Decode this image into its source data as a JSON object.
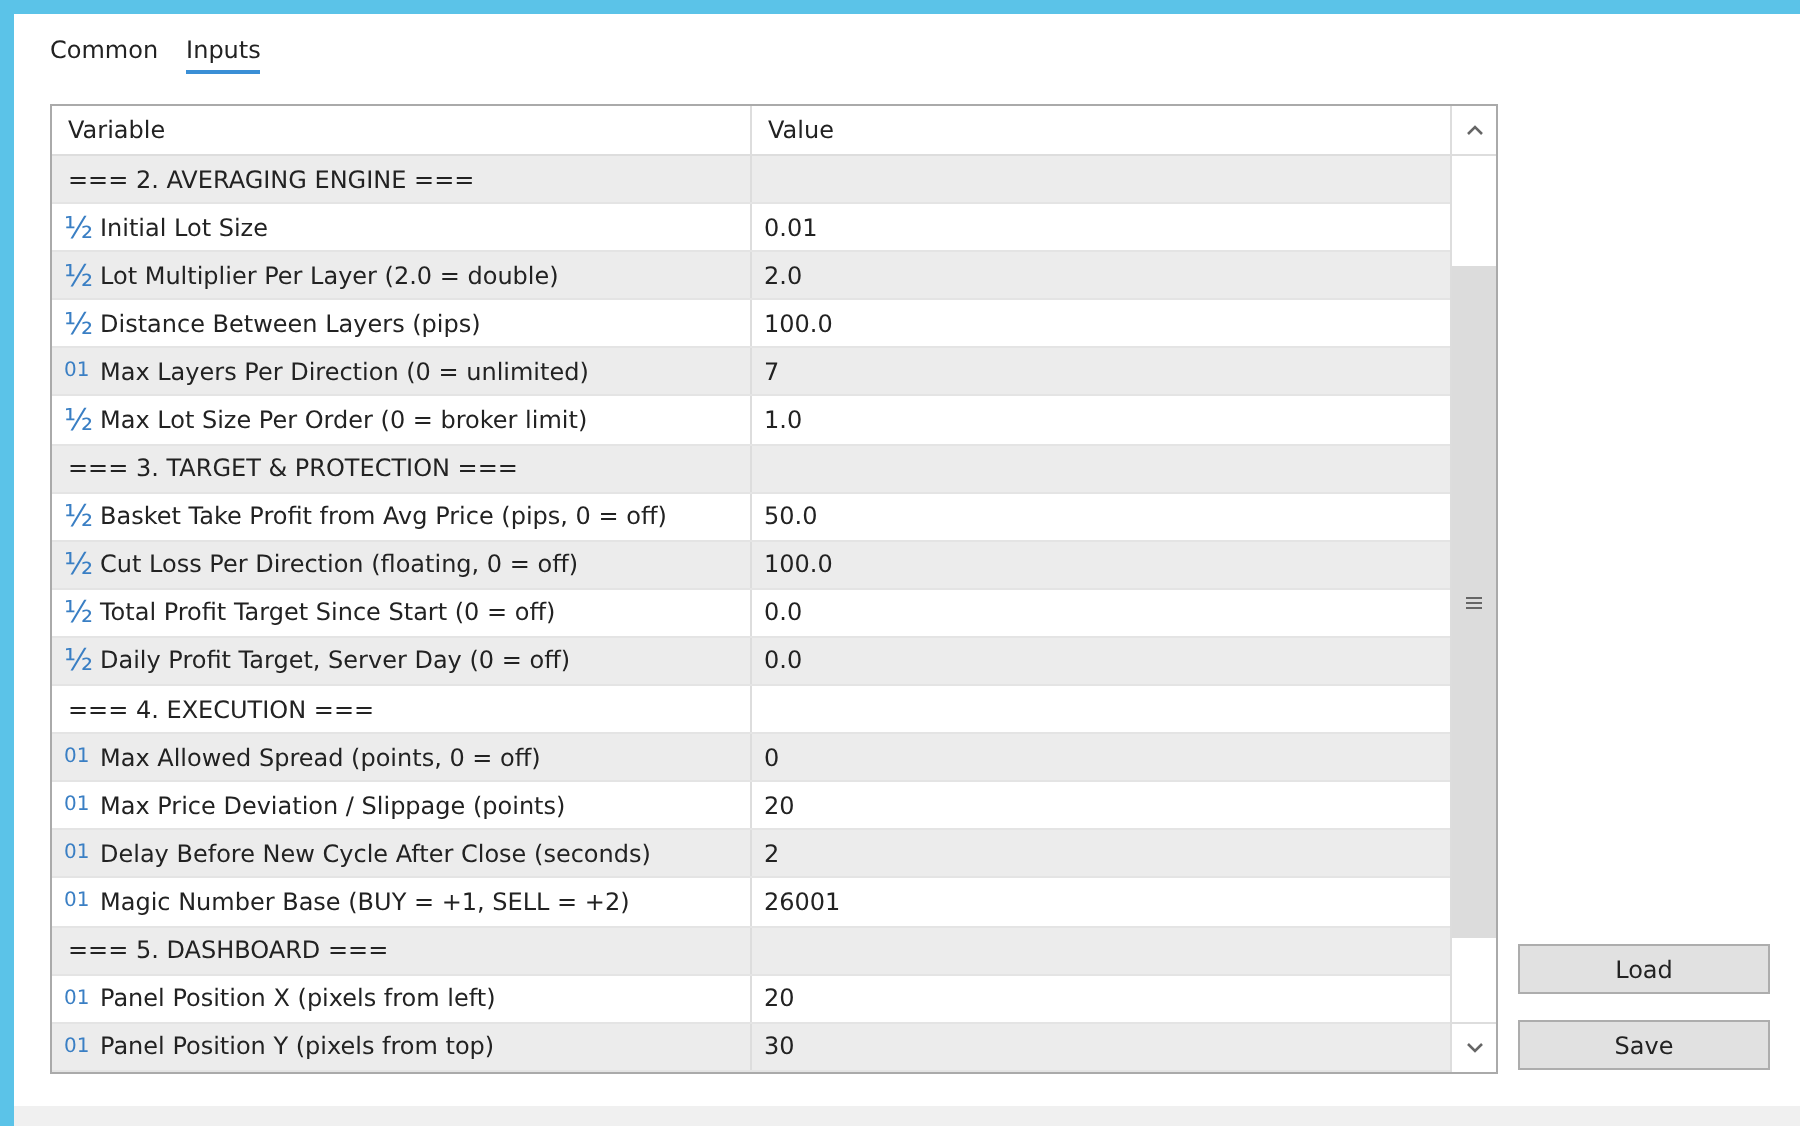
{
  "tabs": [
    {
      "label": "Common",
      "selected": false
    },
    {
      "label": "Inputs",
      "selected": true
    }
  ],
  "table": {
    "columns": [
      "Variable",
      "Value"
    ],
    "rows": [
      {
        "kind": "section",
        "variable": "=== 2. AVERAGING ENGINE ==="
      },
      {
        "kind": "param",
        "type_icon": "½",
        "variable": "Initial Lot Size",
        "value": "0.01"
      },
      {
        "kind": "param",
        "type_icon": "½",
        "variable": "Lot Multiplier Per Layer (2.0 = double)",
        "value": "2.0"
      },
      {
        "kind": "param",
        "type_icon": "½",
        "variable": "Distance Between Layers (pips)",
        "value": "100.0"
      },
      {
        "kind": "param",
        "type_icon": "01",
        "variable": "Max Layers Per Direction (0 = unlimited)",
        "value": "7"
      },
      {
        "kind": "param",
        "type_icon": "½",
        "variable": "Max Lot Size Per Order (0 = broker limit)",
        "value": "1.0"
      },
      {
        "kind": "section",
        "variable": "=== 3. TARGET & PROTECTION ==="
      },
      {
        "kind": "param",
        "type_icon": "½",
        "variable": "Basket Take Profit from Avg Price (pips, 0 = off)",
        "value": "50.0"
      },
      {
        "kind": "param",
        "type_icon": "½",
        "variable": "Cut Loss Per Direction (floating, 0 = off)",
        "value": "100.0"
      },
      {
        "kind": "param",
        "type_icon": "½",
        "variable": "Total Profit Target Since Start (0 = off)",
        "value": "0.0"
      },
      {
        "kind": "param",
        "type_icon": "½",
        "variable": "Daily Profit Target, Server Day (0 = off)",
        "value": "0.0"
      },
      {
        "kind": "section",
        "variable": "=== 4. EXECUTION ==="
      },
      {
        "kind": "param",
        "type_icon": "01",
        "variable": "Max Allowed Spread (points, 0 = off)",
        "value": "0"
      },
      {
        "kind": "param",
        "type_icon": "01",
        "variable": "Max Price Deviation / Slippage (points)",
        "value": "20"
      },
      {
        "kind": "param",
        "type_icon": "01",
        "variable": "Delay Before New Cycle After Close (seconds)",
        "value": "2"
      },
      {
        "kind": "param",
        "type_icon": "01",
        "variable": "Magic Number Base (BUY = +1, SELL = +2)",
        "value": "26001"
      },
      {
        "kind": "section",
        "variable": "=== 5. DASHBOARD ==="
      },
      {
        "kind": "param",
        "type_icon": "01",
        "variable": "Panel Position X (pixels from left)",
        "value": "20"
      },
      {
        "kind": "param",
        "type_icon": "01",
        "variable": "Panel Position Y (pixels from top)",
        "value": "30"
      }
    ]
  },
  "buttons": [
    "Load",
    "Save"
  ]
}
